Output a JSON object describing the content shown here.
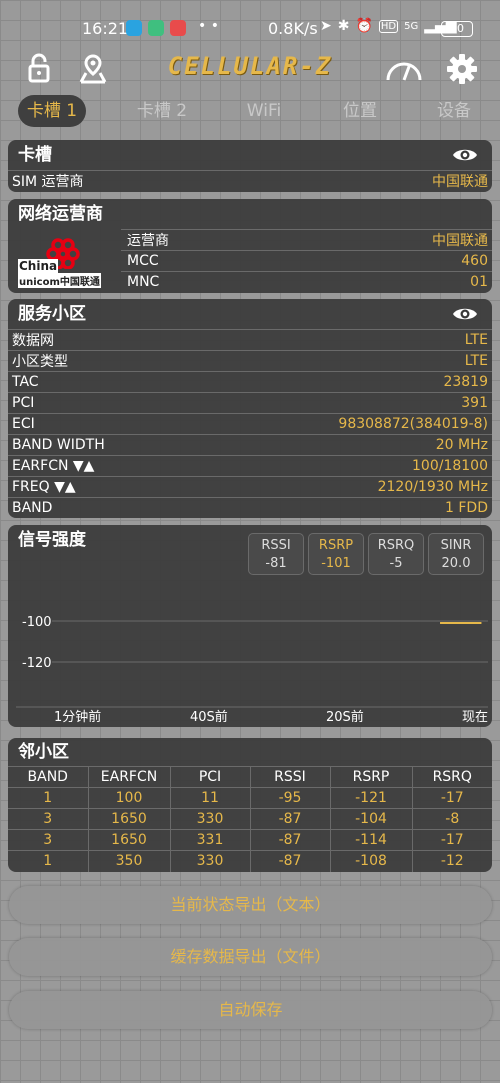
{
  "status_bar": {
    "time": "16:21",
    "speed": "0.8K/s",
    "battery": "70",
    "network": "5G"
  },
  "brand": "CELLULAR-Z",
  "tabs": [
    {
      "label": "卡槽 1"
    },
    {
      "label": "卡槽 2"
    },
    {
      "label": "WiFi"
    },
    {
      "label": "位置"
    },
    {
      "label": "设备"
    }
  ],
  "slot": {
    "title": "卡槽",
    "rows": [
      {
        "key": "SIM 运营商",
        "value": "中国联通"
      }
    ]
  },
  "operator": {
    "title": "网络运营商",
    "logo_text_top": "China",
    "logo_text_bottom": "unicom中国联通",
    "rows": [
      {
        "key": "运营商",
        "value": "中国联通"
      },
      {
        "key": "MCC",
        "value": "460"
      },
      {
        "key": "MNC",
        "value": "01"
      }
    ]
  },
  "cell": {
    "title": "服务小区",
    "rows": [
      {
        "key": "数据网",
        "value": "LTE"
      },
      {
        "key": "小区类型",
        "value": "LTE"
      },
      {
        "key": "TAC",
        "value": "23819"
      },
      {
        "key": "PCI",
        "value": "391"
      },
      {
        "key": "ECI",
        "value": "98308872(384019-8)"
      },
      {
        "key": "BAND WIDTH",
        "value": "20 MHz"
      },
      {
        "key": "EARFCN ▼▲",
        "value": "100/18100"
      },
      {
        "key": "FREQ ▼▲",
        "value": "2120/1930 MHz"
      },
      {
        "key": "BAND",
        "value": "1 FDD"
      }
    ]
  },
  "signal": {
    "title": "信号强度",
    "buttons": [
      {
        "label": "RSSI",
        "value": "-81"
      },
      {
        "label": "RSRP",
        "value": "-101"
      },
      {
        "label": "RSRQ",
        "value": "-5"
      },
      {
        "label": "SINR",
        "value": "20.0"
      }
    ],
    "y_ticks": [
      "-100",
      "-120"
    ],
    "x_ticks": [
      "1分钟前",
      "40S前",
      "20S前",
      "现在"
    ]
  },
  "chart_data": {
    "type": "line",
    "title": "信号强度",
    "xlabel": "",
    "ylabel": "",
    "categories": [
      "1分钟前",
      "40S前",
      "20S前",
      "现在"
    ],
    "y_ticks": [
      -100,
      -120
    ],
    "series": [
      {
        "name": "RSRP",
        "points": [
          [
            0.89,
            -101
          ],
          [
            0.985,
            -101
          ]
        ]
      }
    ]
  },
  "neighbors": {
    "title": "邻小区",
    "headers": [
      "BAND",
      "EARFCN",
      "PCI",
      "RSSI",
      "RSRP",
      "RSRQ"
    ],
    "rows": [
      [
        "1",
        "100",
        "11",
        "-95",
        "-121",
        "-17"
      ],
      [
        "3",
        "1650",
        "330",
        "-87",
        "-104",
        "-8"
      ],
      [
        "3",
        "1650",
        "331",
        "-87",
        "-114",
        "-17"
      ],
      [
        "1",
        "350",
        "330",
        "-87",
        "-108",
        "-12"
      ]
    ]
  },
  "actions": {
    "export_text": "当前状态导出（文本）",
    "export_file": "缓存数据导出（文件）",
    "auto_save": "自动保存"
  },
  "colors": {
    "accent": "#e6b84a",
    "panel": "#3a3a3a",
    "background": "#9a9a9a"
  }
}
